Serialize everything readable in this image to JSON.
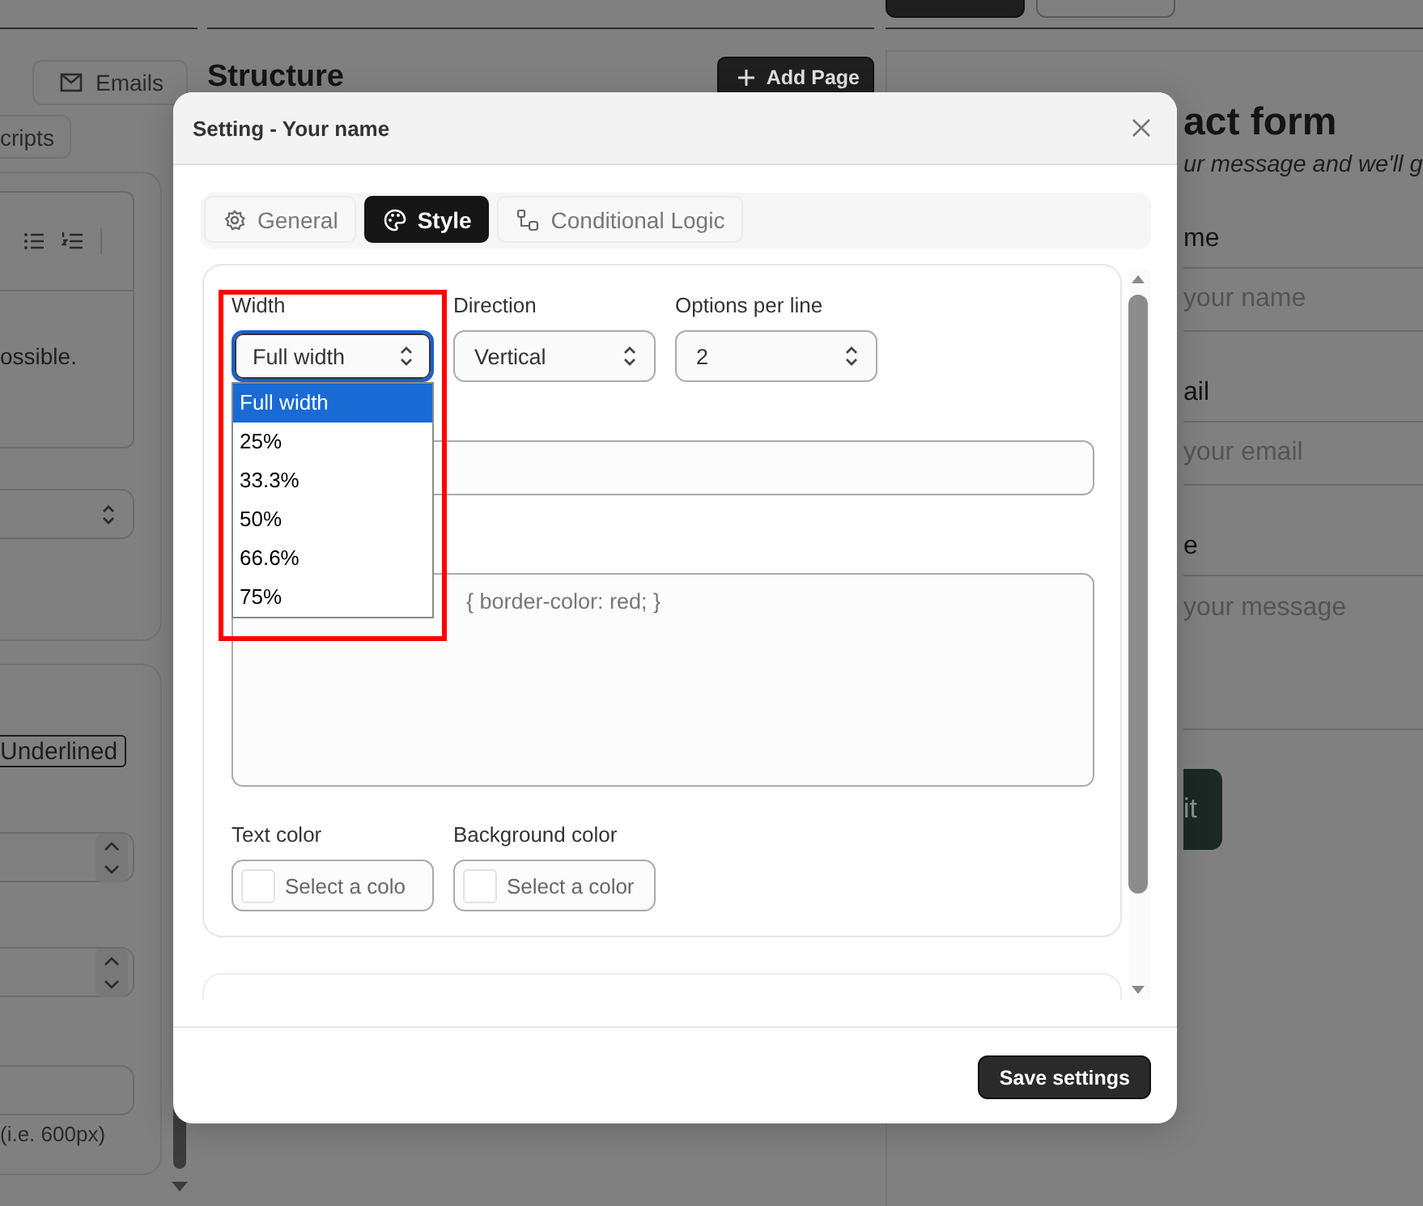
{
  "background": {
    "left_panel": {
      "tabs": [
        {
          "label": "Emails"
        },
        {
          "label": "cripts"
        }
      ],
      "editor_text": "ossible.",
      "style_button": "Underlined",
      "hint": "(i.e. 600px)"
    },
    "structure": {
      "title": "Structure",
      "add_button": "Add Page"
    },
    "preview": {
      "title": "act form",
      "subtitle": "ur message and we'll g",
      "fields": [
        {
          "kind": "input",
          "label": "me",
          "placeholder": "your name"
        },
        {
          "kind": "input",
          "label": "ail",
          "placeholder": "your email"
        },
        {
          "kind": "textarea",
          "label": "e",
          "placeholder": "your message"
        }
      ],
      "submit": "it"
    }
  },
  "dialog": {
    "title": "Setting - Your name",
    "tabs": [
      {
        "label": "General",
        "selected": false
      },
      {
        "label": "Style",
        "selected": true
      },
      {
        "label": "Conditional Logic",
        "selected": false
      }
    ],
    "selects": [
      {
        "label": "Width",
        "value": "Full width",
        "focused": true
      },
      {
        "label": "Direction",
        "value": "Vertical",
        "focused": false
      },
      {
        "label": "Options per line",
        "value": "2",
        "focused": false
      }
    ],
    "dropdown": {
      "options": [
        {
          "label": "Full width",
          "selected": true
        },
        {
          "label": "25%",
          "selected": false
        },
        {
          "label": "33.3%",
          "selected": false
        },
        {
          "label": "50%",
          "selected": false
        },
        {
          "label": "66.6%",
          "selected": false
        },
        {
          "label": "75%",
          "selected": false
        }
      ]
    },
    "css_field": {
      "placeholder": "{ border-color: red; }"
    },
    "color_fields": [
      {
        "label": "Text color",
        "placeholder": "Select a colo"
      },
      {
        "label": "Background color",
        "placeholder": "Select a color"
      }
    ],
    "save_button": "Save settings"
  }
}
